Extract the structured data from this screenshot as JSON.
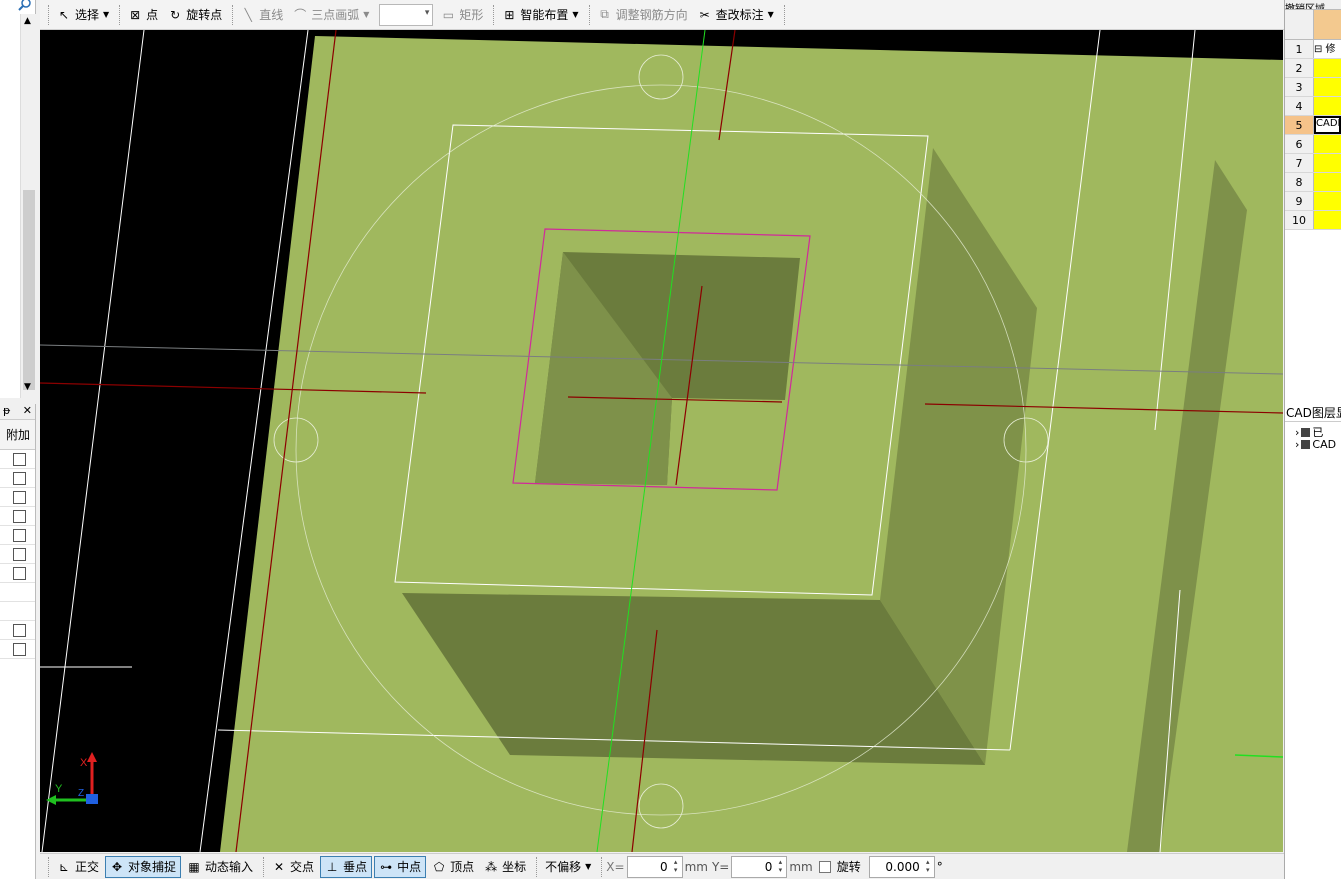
{
  "toolbar": {
    "select_label": "选择",
    "point_label": "点",
    "rotate_point_label": "旋转点",
    "line_label": "直线",
    "arc_label": "三点画弧",
    "rect_label": "矩形",
    "smart_layout_label": "智能布置",
    "adjust_rebar_label": "调整钢筋方向",
    "check_mark_label": "查改标注"
  },
  "left_panel": {
    "column_header": "附加",
    "checkbox_rows": [
      true,
      true,
      true,
      true,
      true,
      true,
      true,
      false,
      false,
      true,
      true
    ]
  },
  "right_panel": {
    "title": "撤销区域",
    "rows": [
      {
        "num": "1",
        "text": "⊟ 修"
      },
      {
        "num": "2",
        "text": ""
      },
      {
        "num": "3",
        "text": ""
      },
      {
        "num": "4",
        "text": ""
      },
      {
        "num": "5",
        "text": "CADI"
      },
      {
        "num": "6",
        "text": ""
      },
      {
        "num": "7",
        "text": ""
      },
      {
        "num": "8",
        "text": ""
      },
      {
        "num": "9",
        "text": ""
      },
      {
        "num": "10",
        "text": ""
      }
    ],
    "layer_title": "CAD图层显",
    "tree": [
      {
        "label": "已"
      },
      {
        "label": "CAD"
      }
    ]
  },
  "canvas": {
    "axis_x": "X",
    "axis_y": "Y",
    "axis_z": "Z"
  },
  "statusbar": {
    "ortho_label": "正交",
    "snap_label": "对象捕捉",
    "dynamic_input_label": "动态输入",
    "intersection_label": "交点",
    "perpendicular_label": "垂点",
    "midpoint_label": "中点",
    "vertex_label": "顶点",
    "coordinate_label": "坐标",
    "offset_label": "不偏移",
    "x_label": "X=",
    "x_value": "0",
    "x_unit": "mm",
    "y_label": "Y=",
    "y_value": "0",
    "y_unit": "mm",
    "rotate_label": "旋转",
    "rotate_value": "0.000",
    "degree": "°"
  }
}
